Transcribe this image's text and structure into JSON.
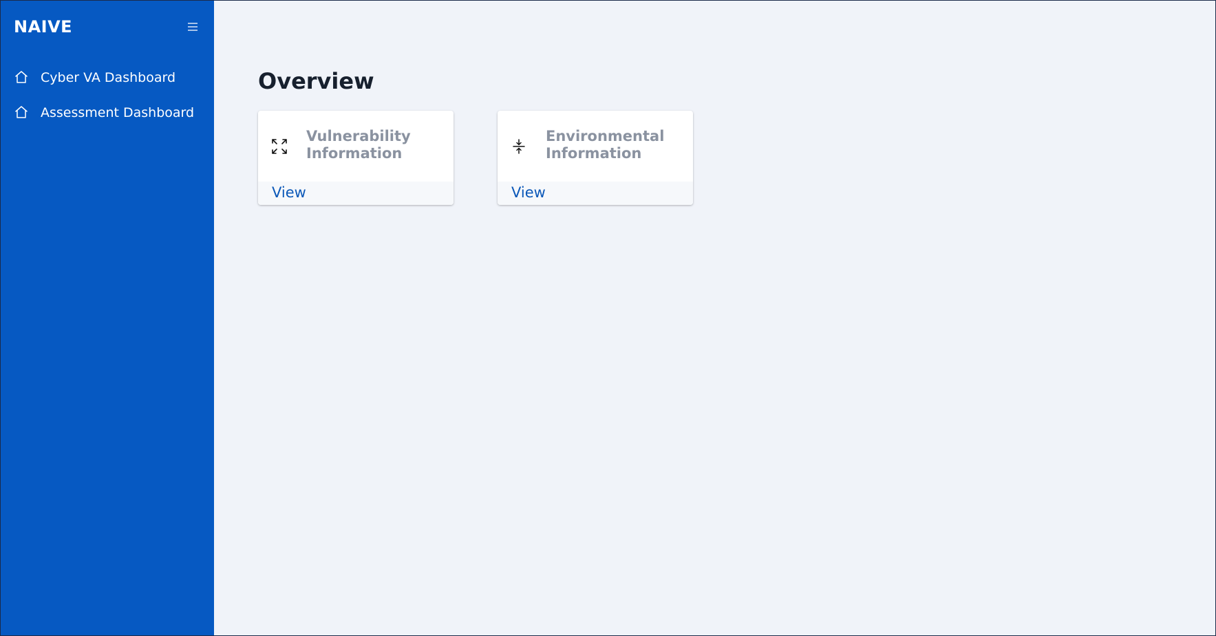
{
  "sidebar": {
    "brand": "NAIVE",
    "menu_icon": "hamburger-menu-icon",
    "items": [
      {
        "label": "Cyber VA Dashboard",
        "icon": "home-icon"
      },
      {
        "label": "Assessment Dashboard",
        "icon": "home-icon"
      }
    ]
  },
  "main": {
    "title": "Overview",
    "cards": [
      {
        "title_line1": "Vulnerability",
        "title_line2": "Information",
        "icon": "expand-arrows-icon",
        "link": "View"
      },
      {
        "title_line1": "Environmental",
        "title_line2": "Information",
        "icon": "compress-vertical-icon",
        "link": "View"
      }
    ]
  },
  "colors": {
    "sidebar_bg": "#0659c2",
    "page_bg": "#f0f3f9",
    "card_title": "#8a92a0",
    "link": "#0b58b8",
    "heading": "#17202e"
  }
}
